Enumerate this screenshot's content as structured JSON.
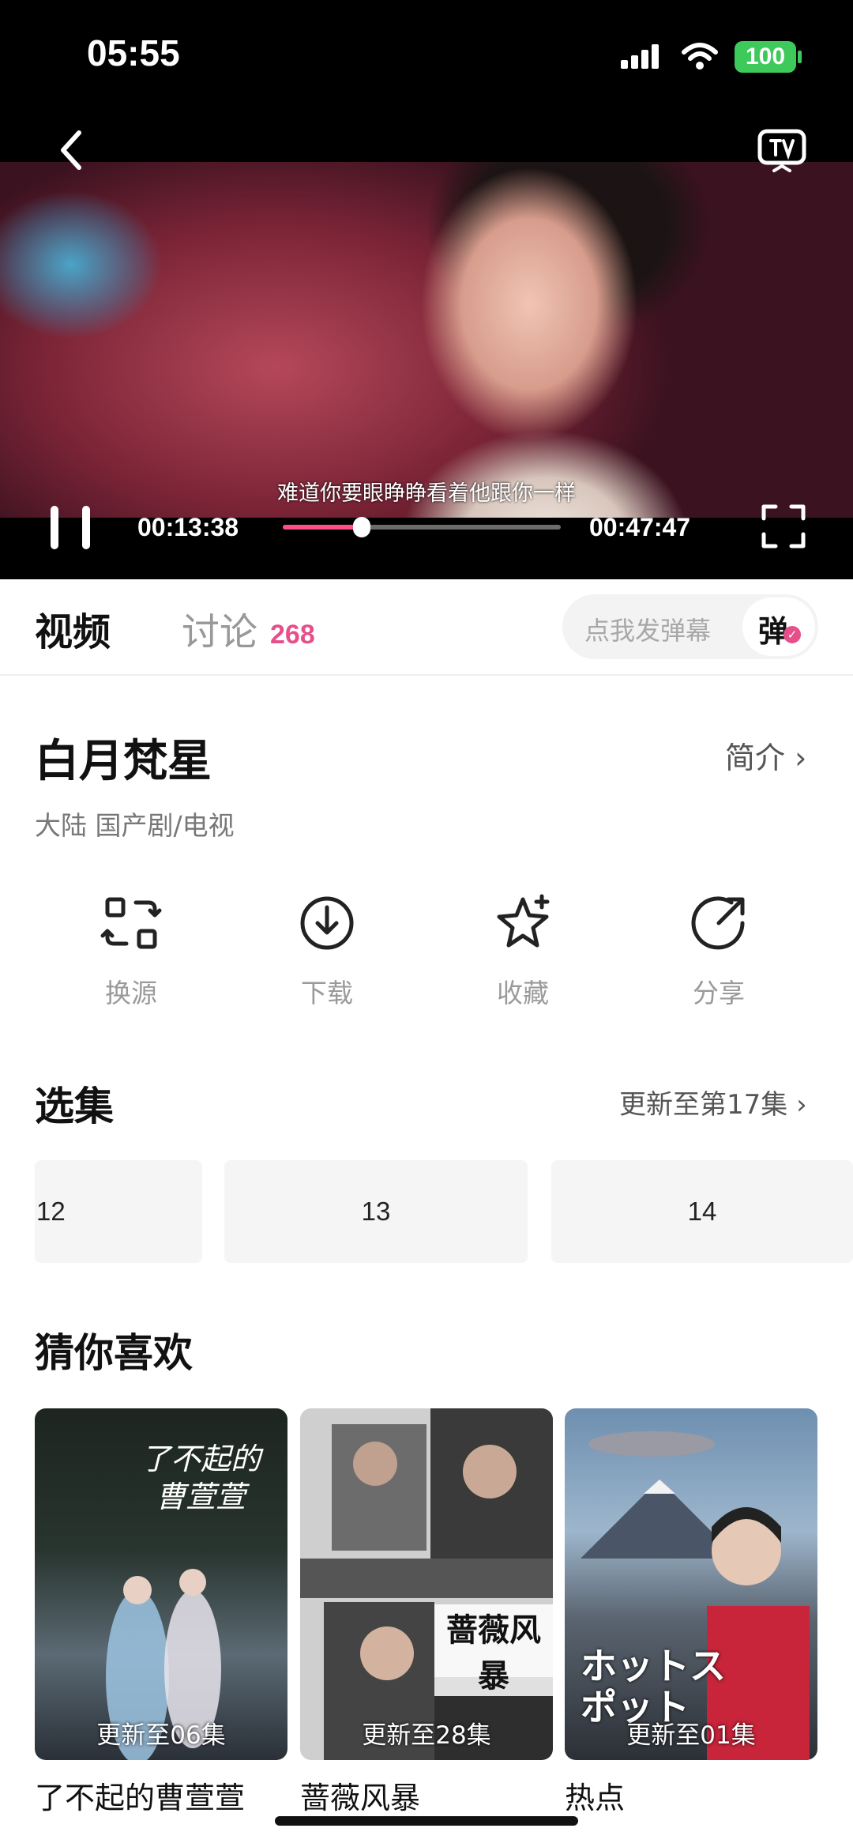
{
  "status_bar": {
    "time": "05:55",
    "battery": "100"
  },
  "player": {
    "subtitle": "难道你要眼睁睁看着他跟你一样",
    "current_time": "00:13:38",
    "total_time": "00:47:47",
    "progress": 0.285,
    "progress_color": "#ff4f8a"
  },
  "tabs": {
    "video": "视频",
    "discuss": "讨论",
    "discuss_count": "268",
    "danmu_placeholder": "点我发弹幕",
    "danmu_button": "弹"
  },
  "show": {
    "title": "白月梵星",
    "intro": "简介",
    "meta": "大陆  国产剧/电视"
  },
  "actions": [
    {
      "label": "换源",
      "icon": "switch-source-icon"
    },
    {
      "label": "下载",
      "icon": "download-icon"
    },
    {
      "label": "收藏",
      "icon": "star-icon"
    },
    {
      "label": "分享",
      "icon": "share-icon"
    }
  ],
  "episodes": {
    "title": "选集",
    "update": "更新至第17集",
    "items": [
      "12",
      "13",
      "14"
    ]
  },
  "recommend": {
    "title": "猜你喜欢",
    "items": [
      {
        "name": "了不起的曹萱萱",
        "badge": "更新至06集",
        "poster_text": "了不起的曹萱萱"
      },
      {
        "name": "蔷薇风暴",
        "badge": "更新至28集",
        "poster_text": "蔷薇风暴"
      },
      {
        "name": "热点",
        "badge": "更新至01集",
        "poster_text": "ホットスポット"
      }
    ]
  },
  "colors": {
    "accent": "#e6508a"
  }
}
